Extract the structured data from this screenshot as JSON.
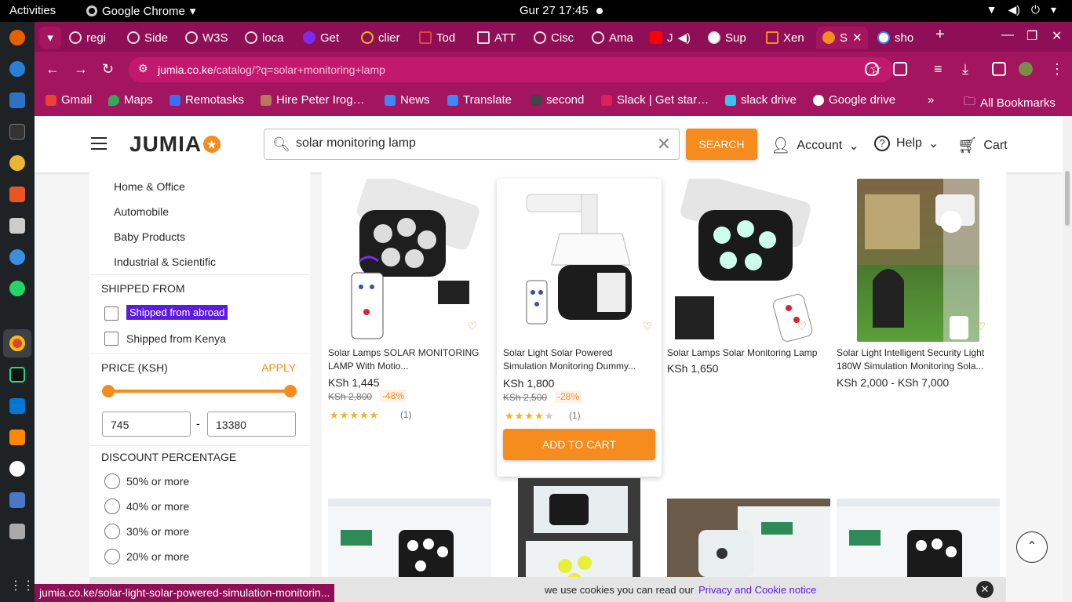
{
  "os": {
    "activities": "Activities",
    "app_name": "Google Chrome",
    "clock": "Gur 27  17:45"
  },
  "browser": {
    "tabs": [
      {
        "label": "regi"
      },
      {
        "label": "Side"
      },
      {
        "label": "W3S"
      },
      {
        "label": "loca"
      },
      {
        "label": "Get"
      },
      {
        "label": "clier"
      },
      {
        "label": "Tod"
      },
      {
        "label": "ATT"
      },
      {
        "label": "Cisc"
      },
      {
        "label": "Ama"
      },
      {
        "label": "J"
      },
      {
        "label": "Sup"
      },
      {
        "label": "Xen"
      },
      {
        "label": "S"
      },
      {
        "label": "sho"
      }
    ],
    "url_domain": "jumia.co.ke",
    "url_path": "/catalog/?q=solar+monitoring+lamp",
    "bookmarks": [
      "Gmail",
      "Maps",
      "Remotasks",
      "Hire Peter Irog…",
      "News",
      "Translate",
      "second",
      "Slack | Get star…",
      "slack drive",
      "Google drive"
    ],
    "all_bookmarks": "All Bookmarks",
    "status_url": "jumia.co.ke/solar-light-solar-powered-simulation-monitorin..."
  },
  "header": {
    "logo": "JUMIA",
    "search_value": "solar monitoring lamp",
    "search_button": "SEARCH",
    "account": "Account",
    "help": "Help",
    "cart": "Cart"
  },
  "sidebar": {
    "categories": [
      "Home & Office",
      "Automobile",
      "Baby Products",
      "Industrial & Scientific"
    ],
    "shipped_from_title": "SHIPPED FROM",
    "shipped_options": [
      "Shipped from abroad",
      "Shipped from Kenya"
    ],
    "price_title": "PRICE (KSH)",
    "apply": "APPLY",
    "price_min": "745",
    "price_max": "13380",
    "price_dash": "-",
    "discount_title": "DISCOUNT PERCENTAGE",
    "discount_options": [
      "50% or more",
      "40% or more",
      "30% or more",
      "20% or more"
    ]
  },
  "products": [
    {
      "name": "Solar Lamps SOLAR MONITORING LAMP With Motio...",
      "price": "KSh 1,445",
      "old_price": "KSh 2,800",
      "discount": "-48%",
      "rating": 5,
      "reviews": "(1)"
    },
    {
      "name": "Solar Light Solar Powered Simulation Monitoring Dummy...",
      "price": "KSh 1,800",
      "old_price": "KSh 2,500",
      "discount": "-28%",
      "rating": 4,
      "reviews": "(1)",
      "add_to_cart": "ADD TO CART"
    },
    {
      "name": "Solar Lamps Solar Monitoring Lamp",
      "price": "KSh 1,650"
    },
    {
      "name": "Solar Light Intelligent Security Light 180W Simulation Monitoring Sola...",
      "price": "KSh 2,000 - KSh 7,000"
    }
  ],
  "cookie": {
    "text": "we use cookies you can read our",
    "link": "Privacy and Cookie notice"
  },
  "colors": {
    "brand": "#f68b1e",
    "chrome_frame": "#a3155f",
    "highlight": "#5e1be0"
  }
}
